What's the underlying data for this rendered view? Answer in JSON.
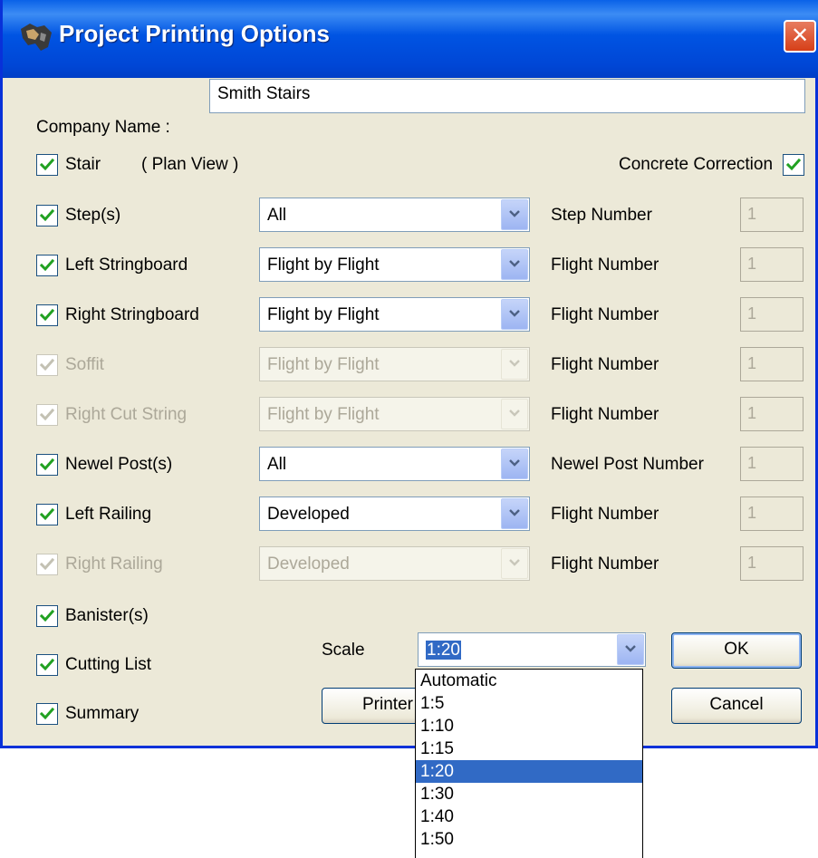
{
  "window": {
    "title": "Project Printing Options",
    "close_glyph": "✕"
  },
  "company": {
    "label": "Company Name :",
    "value": "Smith Stairs"
  },
  "stair": {
    "label": "Stair",
    "note": "( Plan View )",
    "checked": true
  },
  "concrete_correction": {
    "label": "Concrete Correction",
    "checked": true
  },
  "rows": [
    {
      "label": "Step(s)",
      "select": "All",
      "number_label": "Step Number",
      "number": "1",
      "enabled": true
    },
    {
      "label": "Left Stringboard",
      "select": "Flight by Flight",
      "number_label": "Flight Number",
      "number": "1",
      "enabled": true
    },
    {
      "label": "Right Stringboard",
      "select": "Flight by Flight",
      "number_label": "Flight Number",
      "number": "1",
      "enabled": true
    },
    {
      "label": "Soffit",
      "select": "Flight by Flight",
      "number_label": "Flight Number",
      "number": "1",
      "enabled": false
    },
    {
      "label": "Right Cut String",
      "select": "Flight by Flight",
      "number_label": "Flight Number",
      "number": "1",
      "enabled": false
    },
    {
      "label": "Newel Post(s)",
      "select": "All",
      "number_label": "Newel Post Number",
      "number": "1",
      "enabled": true
    },
    {
      "label": "Left Railing",
      "select": "Developed",
      "number_label": "Flight Number",
      "number": "1",
      "enabled": true
    },
    {
      "label": "Right Railing",
      "select": "Developed",
      "number_label": "Flight Number",
      "number": "1",
      "enabled": false
    }
  ],
  "extras": [
    {
      "label": "Banister(s)",
      "checked": true
    },
    {
      "label": "Cutting List",
      "checked": true
    },
    {
      "label": "Summary",
      "checked": true
    }
  ],
  "scale": {
    "label": "Scale",
    "value": "1:20",
    "options": [
      "Automatic",
      "1:5",
      "1:10",
      "1:15",
      "1:20",
      "1:30",
      "1:40",
      "1:50"
    ],
    "selected_index": 4
  },
  "buttons": {
    "ok": "OK",
    "cancel": "Cancel",
    "printer": "Printer"
  },
  "colors": {
    "titlebar": "#0054e3",
    "dialog_bg": "#ece9d8",
    "selection": "#316ac5",
    "check": "#21a121"
  }
}
